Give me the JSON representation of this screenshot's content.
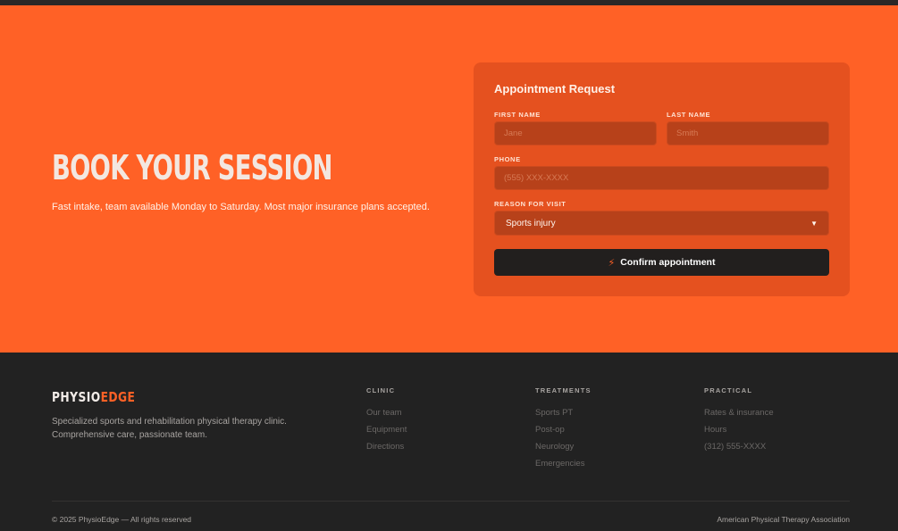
{
  "hero": {
    "title": "BOOK YOUR SESSION",
    "subtitle": "Fast intake, team available Monday to Saturday. Most major insurance plans accepted."
  },
  "form": {
    "title": "Appointment Request",
    "first_name": {
      "label": "FIRST NAME",
      "placeholder": "Jane"
    },
    "last_name": {
      "label": "LAST NAME",
      "placeholder": "Smith"
    },
    "phone": {
      "label": "PHONE",
      "placeholder": "(555) XXX-XXXX"
    },
    "reason": {
      "label": "REASON FOR VISIT",
      "selected": "Sports injury"
    },
    "submit_label": "Confirm appointment"
  },
  "footer": {
    "brand_part1": "PHYSIO",
    "brand_part2": "EDGE",
    "description": "Specialized sports and rehabilitation physical therapy clinic. Comprehensive care, passionate team.",
    "columns": [
      {
        "heading": "CLINIC",
        "links": [
          "Our team",
          "Equipment",
          "Directions"
        ]
      },
      {
        "heading": "TREATMENTS",
        "links": [
          "Sports PT",
          "Post-op",
          "Neurology",
          "Emergencies"
        ]
      },
      {
        "heading": "PRACTICAL",
        "links": [
          "Rates & insurance",
          "Hours",
          "(312) 555-XXXX"
        ]
      }
    ],
    "copyright": "© 2025 PhysioEdge — All rights reserved",
    "association": "American Physical Therapy Association"
  },
  "colors": {
    "accent": "#ff6126",
    "card": "#e5511f",
    "field": "#b7411a",
    "dark": "#222222"
  },
  "icons": {
    "submit": "bolt-icon",
    "select": "chevron-down-icon"
  }
}
